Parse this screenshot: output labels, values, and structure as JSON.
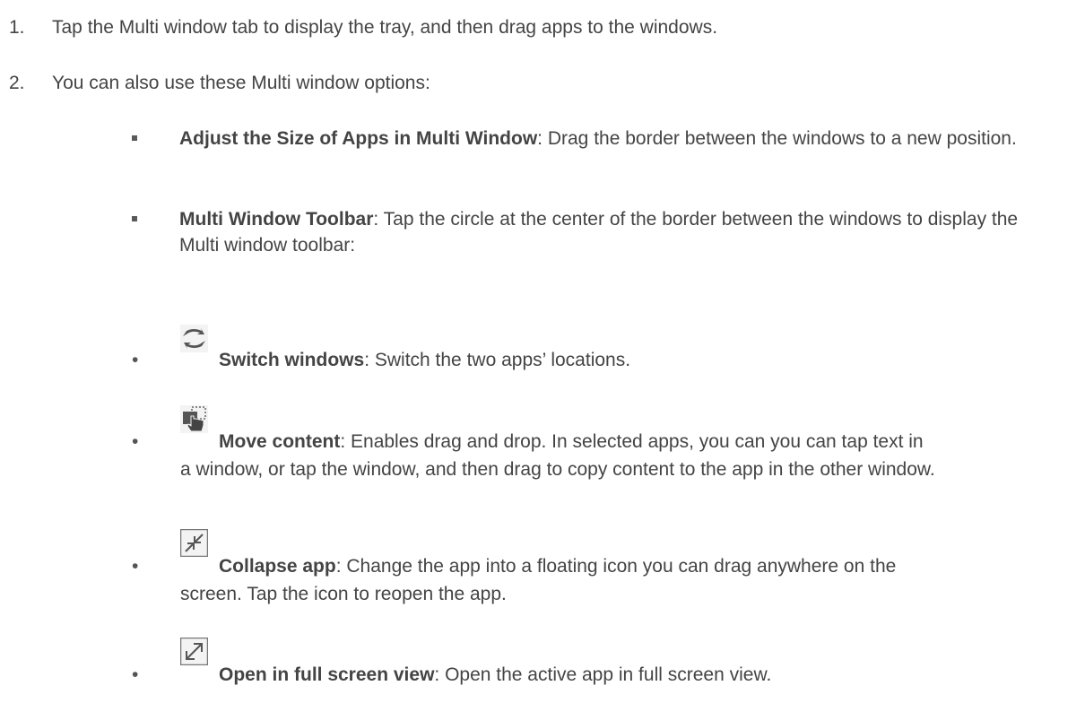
{
  "steps": [
    {
      "num": "1.",
      "text": "Tap the Multi window tab to display the tray, and then drag apps to the windows."
    },
    {
      "num": "2.",
      "text": "You can also use these Multi window options:"
    }
  ],
  "options": [
    {
      "title": "Adjust the Size of Apps in Multi Window",
      "desc": ": Drag the border between the windows to a new position."
    },
    {
      "title": "Multi Window Toolbar",
      "desc": ": Tap the circle at the center of the border between the windows to display the Multi window toolbar:"
    }
  ],
  "toolbar_items": [
    {
      "bullet": "•",
      "icon": "switch-windows-icon",
      "title": "Switch windows",
      "line1": ": Switch the two apps’ locations.",
      "line2": ""
    },
    {
      "bullet": "•",
      "icon": "move-content-icon",
      "title": "Move content",
      "line1": ": Enables drag and drop. In selected apps, you can you can tap text in",
      "line2": "a window, or tap the window, and then drag to copy content to the app in the other window."
    },
    {
      "bullet": "•",
      "icon": "collapse-app-icon",
      "title": "Collapse app",
      "line1": ": Change the app into a floating icon you can drag anywhere on the",
      "line2": "screen. Tap the icon to reopen the app."
    },
    {
      "bullet": "•",
      "icon": "full-screen-icon",
      "title": "Open in full screen view",
      "line1": ": Open the active app in full screen view.",
      "line2": ""
    }
  ]
}
